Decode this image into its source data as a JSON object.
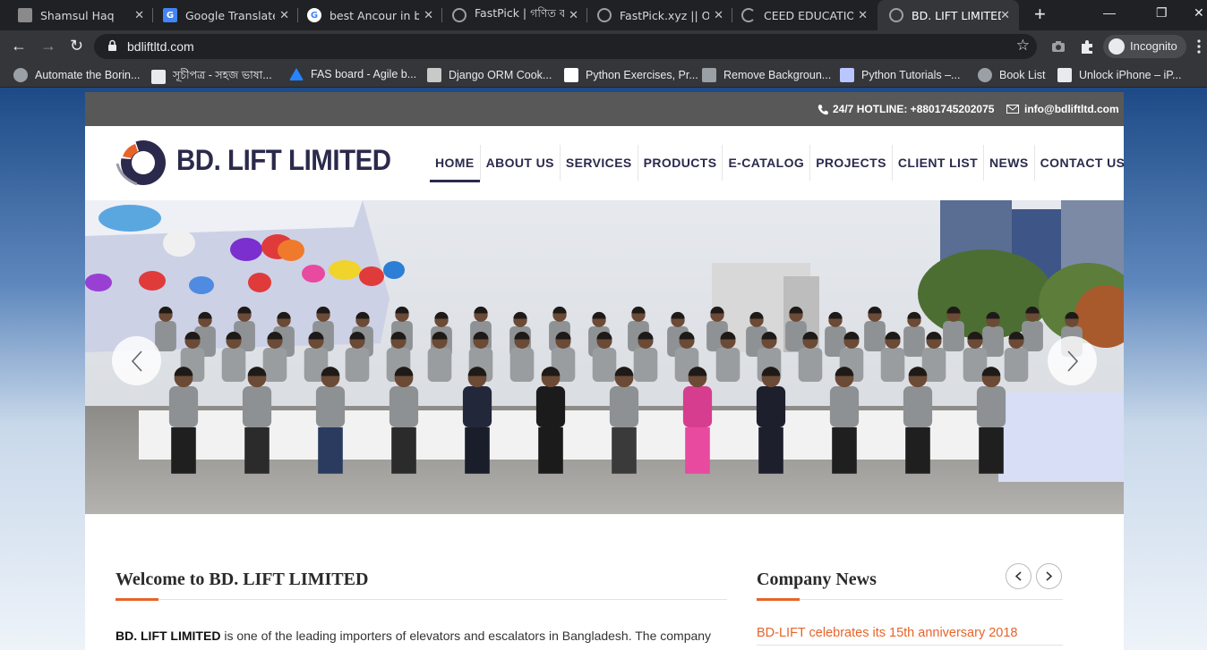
{
  "browser": {
    "tabs": [
      {
        "title": "Shamsul Haq",
        "favicon": "profile-favicon",
        "color": "#8a8a8a"
      },
      {
        "title": "Google Translate",
        "favicon": "google-translate-favicon",
        "color": "#4285f4"
      },
      {
        "title": "best Ancour in bd",
        "favicon": "google-favicon",
        "color": "#ffffff"
      },
      {
        "title": "FastPick | গণিত ক্যা",
        "favicon": "globe-favicon",
        "color": "#9aa0a6"
      },
      {
        "title": "FastPick.xyz || Onli",
        "favicon": "globe-favicon",
        "color": "#9aa0a6"
      },
      {
        "title": "CEED EDUCATION",
        "favicon": "loading-spinner-icon",
        "color": "#9aa0a6"
      },
      {
        "title": "BD. LIFT LIMITED",
        "favicon": "globe-favicon",
        "color": "#9aa0a6",
        "active": true
      }
    ],
    "url": "bdliftltd.com",
    "profile_label": "Incognito",
    "bookmarks": [
      {
        "label": "Automate the Borin...",
        "icon": "globe-icon"
      },
      {
        "label": "সূচীপত্র - সহজ ভাষা...",
        "icon": "list-icon"
      },
      {
        "label": "FAS board - Agile b...",
        "icon": "jira-icon"
      },
      {
        "label": "Django ORM Cook...",
        "icon": "book-icon"
      },
      {
        "label": "Python Exercises, Pr...",
        "icon": "w3-icon"
      },
      {
        "label": "Remove Backgroun...",
        "icon": "layers-icon"
      },
      {
        "label": "Python Tutorials –...",
        "icon": "python-icon"
      },
      {
        "label": "Book List",
        "icon": "globe-icon"
      },
      {
        "label": "Unlock iPhone – iP...",
        "icon": "phone-icon"
      }
    ]
  },
  "site": {
    "hotline": "24/7 HOTLINE: +8801745202075",
    "email": "info@bdliftltd.com",
    "brand": "BD. LIFT LIMITED",
    "menu": [
      "HOME",
      "ABOUT US",
      "SERVICES",
      "PRODUCTS",
      "E-CATALOG",
      "PROJECTS",
      "CLIENT LIST",
      "NEWS",
      "CONTACT US"
    ],
    "active_menu": "HOME",
    "welcome_title": "Welcome to BD. LIFT LIMITED",
    "intro_bold": "BD. LIFT LIMITED",
    "intro_text": " is one of the leading importers of elevators and escalators in Bangladesh. The company",
    "news_title": "Company News",
    "news_item": "BD-LIFT celebrates its 15th anniversary 2018",
    "accent_color": "#e8632a",
    "brand_color": "#2b2a4c"
  }
}
